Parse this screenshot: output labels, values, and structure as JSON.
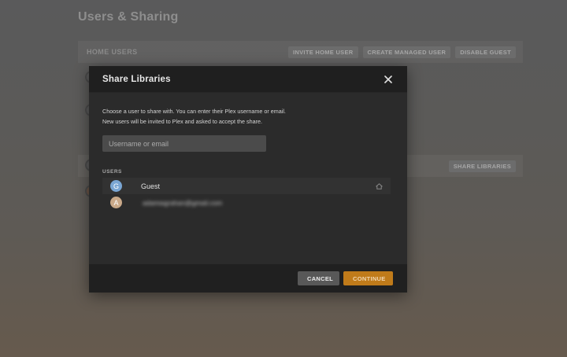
{
  "page": {
    "title": "Users & Sharing",
    "home_users": {
      "label": "HOME USERS",
      "buttons": [
        "INVITE HOME USER",
        "CREATE MANAGED USER",
        "DISABLE GUEST"
      ]
    },
    "share_section": {
      "button": "SHARE LIBRARIES"
    }
  },
  "modal": {
    "title": "Share Libraries",
    "close_icon": "close-icon",
    "description": [
      "Choose a user to share with. You can enter their Plex username or email.",
      "New users will be invited to Plex and asked to accept the share."
    ],
    "input": {
      "placeholder": "Username or email",
      "value": ""
    },
    "users_label": "USERS",
    "users": [
      {
        "initial": "G",
        "name": "Guest",
        "avatar_color": "#7aa6d4",
        "icon": "home-icon"
      },
      {
        "initial": "A",
        "name": "adamwgrahan@gmail.com",
        "avatar_color": "#c9a989",
        "icon": ""
      }
    ],
    "buttons": {
      "cancel": "CANCEL",
      "continue": "CONTINUE"
    }
  },
  "colors": {
    "accent": "#c07b1a",
    "modal_bg": "#2b2b2b",
    "header_bg": "#1f1f1f"
  }
}
